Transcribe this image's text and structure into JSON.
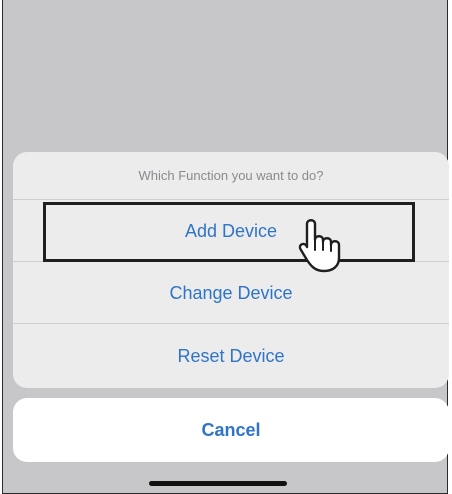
{
  "action_sheet": {
    "title": "Which Function you want to do?",
    "options": [
      "Add Device",
      "Change Device",
      "Reset Device"
    ]
  },
  "cancel_label": "Cancel",
  "colors": {
    "accent": "#2f74c7",
    "overlay": "#c7c7c9",
    "sheet_bg": "#ececed"
  },
  "icons": {
    "pointer": "hand-pointer-icon"
  }
}
